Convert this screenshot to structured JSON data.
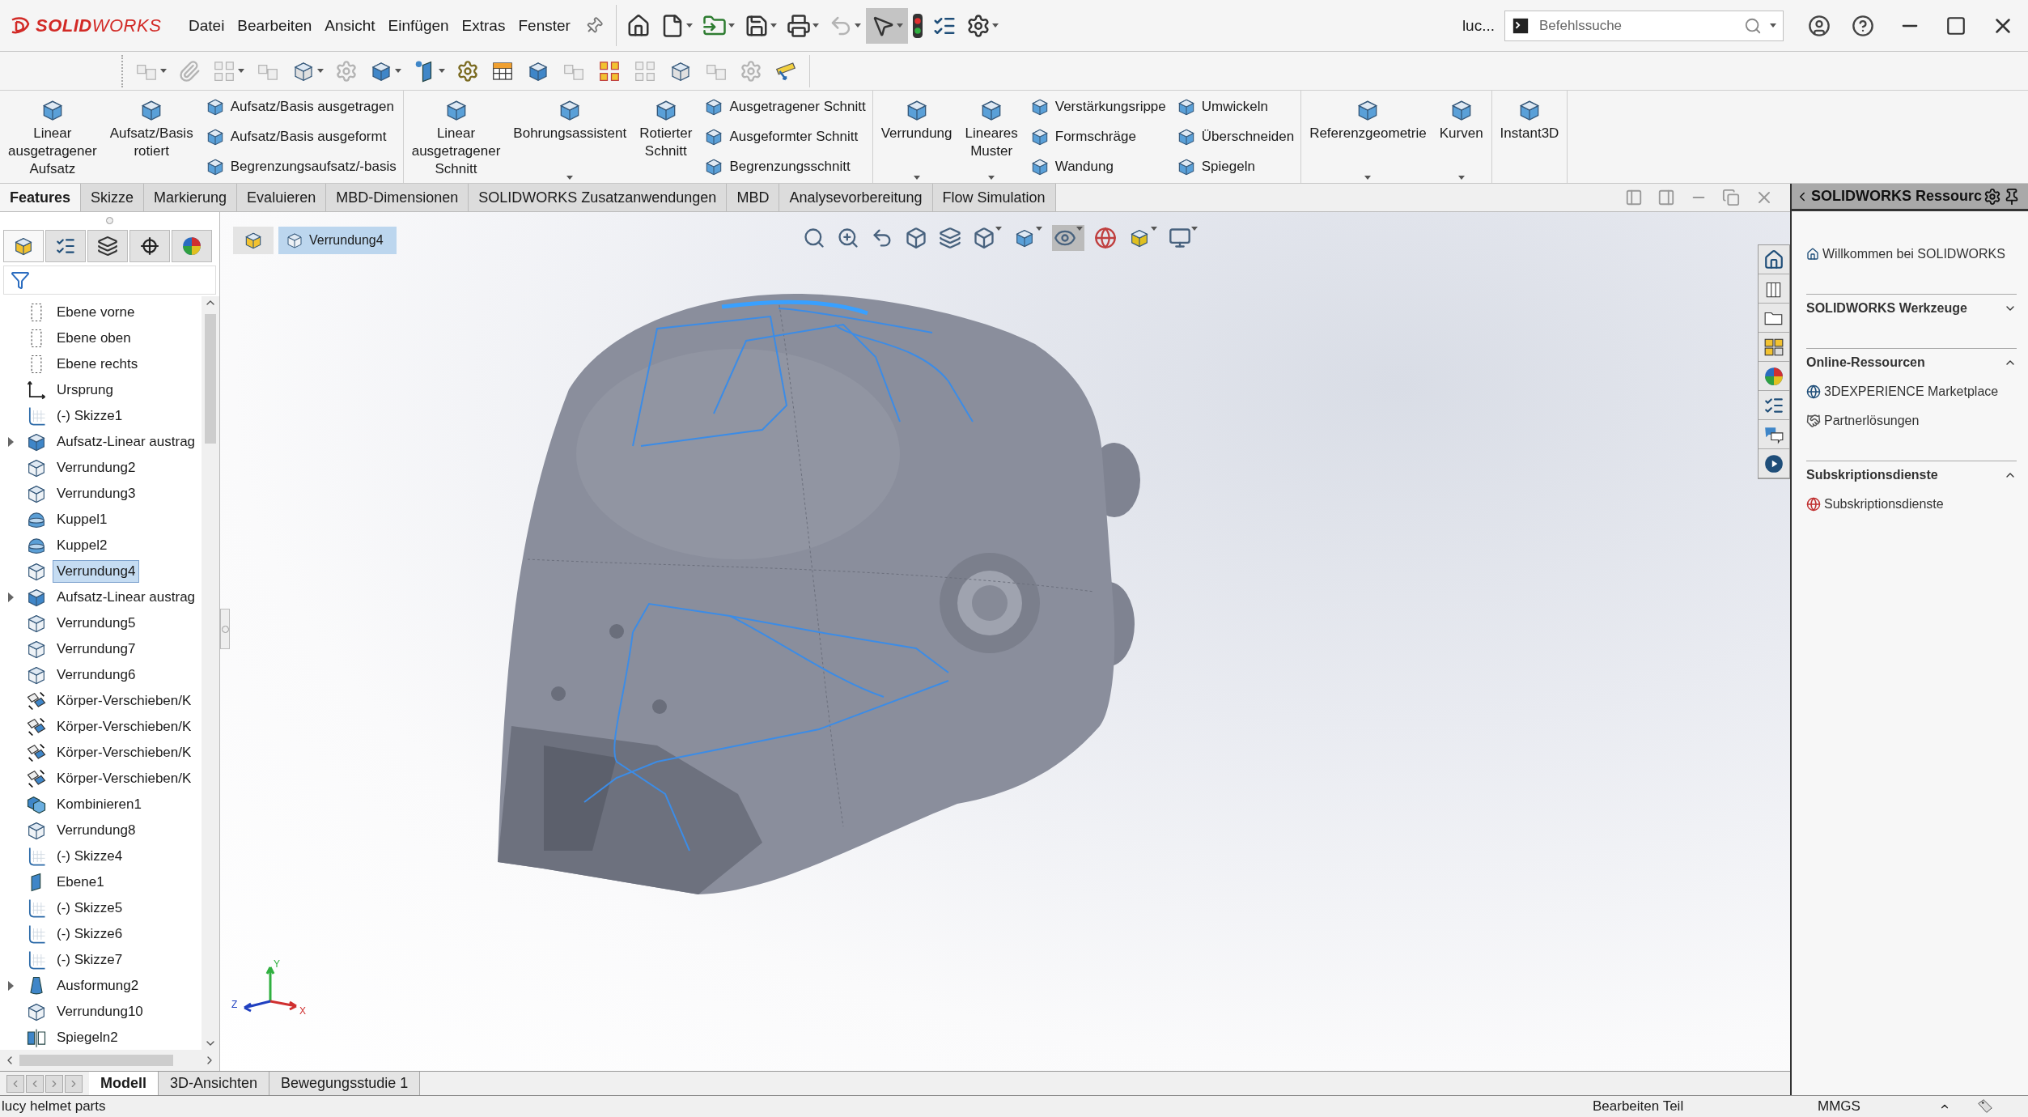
{
  "app": {
    "logo": "**SOLID**WORKS"
  },
  "menu": [
    "Datei",
    "Bearbeiten",
    "Ansicht",
    "Einfügen",
    "Extras",
    "Fenster"
  ],
  "main_toolbar": [
    {
      "kind": "home",
      "menu": false,
      "disabled": false,
      "pressed": false
    },
    {
      "kind": "new",
      "menu": true,
      "disabled": false,
      "pressed": false
    },
    {
      "kind": "open",
      "menu": true,
      "disabled": false,
      "pressed": false
    },
    {
      "kind": "save",
      "menu": true,
      "disabled": false,
      "pressed": false
    },
    {
      "kind": "print",
      "menu": true,
      "disabled": false,
      "pressed": false
    },
    {
      "kind": "undo",
      "menu": true,
      "disabled": true,
      "pressed": false
    },
    {
      "kind": "select",
      "menu": true,
      "disabled": false,
      "pressed": true
    },
    {
      "kind": "traffic",
      "menu": false,
      "disabled": false,
      "pressed": false
    },
    {
      "kind": "list",
      "menu": false,
      "disabled": false,
      "pressed": false
    },
    {
      "kind": "gear",
      "menu": true,
      "disabled": false,
      "pressed": false
    }
  ],
  "user": "luc...",
  "search": {
    "placeholder": "Befehlssuche"
  },
  "quick_toolbar": [
    {
      "kind": "parts",
      "disabled": true,
      "menu": true
    },
    {
      "kind": "clip",
      "disabled": true,
      "menu": false
    },
    {
      "kind": "grid",
      "disabled": true,
      "menu": true
    },
    {
      "kind": "parts",
      "disabled": true,
      "menu": false
    },
    {
      "kind": "box",
      "disabled": true,
      "menu": true
    },
    {
      "kind": "gears",
      "disabled": true,
      "menu": false
    },
    {
      "kind": "box",
      "disabled": false,
      "menu": true
    },
    {
      "kind": "plane",
      "disabled": false,
      "menu": true
    },
    {
      "kind": "gears",
      "disabled": false,
      "menu": false
    },
    {
      "kind": "table",
      "disabled": false,
      "menu": false
    },
    {
      "kind": "box",
      "disabled": false,
      "menu": false
    },
    {
      "kind": "parts",
      "disabled": true,
      "menu": false
    },
    {
      "kind": "grid",
      "disabled": false,
      "menu": false
    },
    {
      "kind": "grid",
      "disabled": true,
      "menu": false
    },
    {
      "kind": "box",
      "disabled": true,
      "menu": false
    },
    {
      "kind": "parts",
      "disabled": true,
      "menu": false
    },
    {
      "kind": "gears",
      "disabled": true,
      "menu": false
    },
    {
      "kind": "ruler",
      "disabled": false,
      "menu": false
    }
  ],
  "ribbon": [
    {
      "items": [
        {
          "kind": "large",
          "label": "Linear\nausgetragener\nAufsatz",
          "menu": false
        },
        {
          "kind": "large",
          "label": "Aufsatz/Basis\nrotiert",
          "menu": false
        },
        {
          "kind": "column",
          "items": [
            "Aufsatz/Basis ausgetragen",
            "Aufsatz/Basis ausgeformt",
            "Begrenzungsaufsatz/-basis"
          ]
        }
      ]
    },
    {
      "items": [
        {
          "kind": "large",
          "label": "Linear\nausgetragener\nSchnitt",
          "menu": false
        },
        {
          "kind": "large",
          "label": "Bohrungsassistent",
          "menu": true
        },
        {
          "kind": "large",
          "label": "Rotierter\nSchnitt",
          "menu": false
        },
        {
          "kind": "column",
          "items": [
            "Ausgetragener Schnitt",
            "Ausgeformter Schnitt",
            "Begrenzungsschnitt"
          ]
        }
      ]
    },
    {
      "items": [
        {
          "kind": "large",
          "label": "Verrundung",
          "menu": true
        },
        {
          "kind": "large",
          "label": "Lineares\nMuster",
          "menu": true
        },
        {
          "kind": "column",
          "items": [
            "Verstärkungsrippe",
            "Formschräge",
            "Wandung"
          ]
        },
        {
          "kind": "column",
          "items": [
            "Umwickeln",
            "Überschneiden",
            "Spiegeln"
          ]
        }
      ]
    },
    {
      "items": [
        {
          "kind": "large",
          "label": "Referenzgeometrie",
          "menu": true
        },
        {
          "kind": "large",
          "label": "Kurven",
          "menu": true
        }
      ]
    },
    {
      "items": [
        {
          "kind": "large",
          "label": "Instant3D",
          "menu": false
        }
      ]
    }
  ],
  "feature_tabs": [
    {
      "label": "Features",
      "selected": true
    },
    {
      "label": "Skizze",
      "selected": false
    },
    {
      "label": "Markierung",
      "selected": false
    },
    {
      "label": "Evaluieren",
      "selected": false
    },
    {
      "label": "MBD-Dimensionen",
      "selected": false
    },
    {
      "label": "SOLIDWORKS Zusatzanwendungen",
      "selected": false
    },
    {
      "label": "MBD",
      "selected": false
    },
    {
      "label": "Analysevorbereitung",
      "selected": false
    },
    {
      "label": "Flow Simulation",
      "selected": false
    }
  ],
  "tree": {
    "items": [
      {
        "label": "Ebene vorne",
        "kind": "plane",
        "expandable": false,
        "selected": false
      },
      {
        "label": "Ebene oben",
        "kind": "plane",
        "expandable": false,
        "selected": false
      },
      {
        "label": "Ebene rechts",
        "kind": "plane",
        "expandable": false,
        "selected": false
      },
      {
        "label": "Ursprung",
        "kind": "origin",
        "expandable": false,
        "selected": false
      },
      {
        "label": "(-) Skizze1",
        "kind": "sketch",
        "expandable": false,
        "selected": false
      },
      {
        "label": "Aufsatz-Linear austrag",
        "kind": "extrude",
        "expandable": true,
        "selected": false
      },
      {
        "label": "Verrundung2",
        "kind": "fillet",
        "expandable": false,
        "selected": false
      },
      {
        "label": "Verrundung3",
        "kind": "fillet",
        "expandable": false,
        "selected": false
      },
      {
        "label": "Kuppel1",
        "kind": "dome",
        "expandable": false,
        "selected": false
      },
      {
        "label": "Kuppel2",
        "kind": "dome",
        "expandable": false,
        "selected": false
      },
      {
        "label": "Verrundung4",
        "kind": "fillet",
        "expandable": false,
        "selected": true
      },
      {
        "label": "Aufsatz-Linear austrag",
        "kind": "extrude",
        "expandable": true,
        "selected": false
      },
      {
        "label": "Verrundung5",
        "kind": "fillet",
        "expandable": false,
        "selected": false
      },
      {
        "label": "Verrundung7",
        "kind": "fillet",
        "expandable": false,
        "selected": false
      },
      {
        "label": "Verrundung6",
        "kind": "fillet",
        "expandable": false,
        "selected": false
      },
      {
        "label": "Körper-Verschieben/K",
        "kind": "move",
        "expandable": false,
        "selected": false
      },
      {
        "label": "Körper-Verschieben/K",
        "kind": "move",
        "expandable": false,
        "selected": false
      },
      {
        "label": "Körper-Verschieben/K",
        "kind": "move",
        "expandable": false,
        "selected": false
      },
      {
        "label": "Körper-Verschieben/K",
        "kind": "move",
        "expandable": false,
        "selected": false
      },
      {
        "label": "Kombinieren1",
        "kind": "combine",
        "expandable": false,
        "selected": false
      },
      {
        "label": "Verrundung8",
        "kind": "fillet",
        "expandable": false,
        "selected": false
      },
      {
        "label": "(-) Skizze4",
        "kind": "sketch",
        "expandable": false,
        "selected": false
      },
      {
        "label": "Ebene1",
        "kind": "refplane",
        "expandable": false,
        "selected": false
      },
      {
        "label": "(-) Skizze5",
        "kind": "sketch",
        "expandable": false,
        "selected": false
      },
      {
        "label": "(-) Skizze6",
        "kind": "sketch",
        "expandable": false,
        "selected": false
      },
      {
        "label": "(-) Skizze7",
        "kind": "sketch",
        "expandable": false,
        "selected": false
      },
      {
        "label": "Ausformung2",
        "kind": "loft",
        "expandable": true,
        "selected": false
      },
      {
        "label": "Verrundung10",
        "kind": "fillet",
        "expandable": false,
        "selected": false
      },
      {
        "label": "Spiegeln2",
        "kind": "mirror",
        "expandable": false,
        "selected": false
      }
    ]
  },
  "panel_tabs": [
    {
      "selected": true
    },
    {
      "selected": false
    },
    {
      "selected": false
    },
    {
      "selected": false
    },
    {
      "selected": false
    }
  ],
  "breadcrumb": "Verrundung4",
  "triad_labels": [
    "Y",
    "Z",
    "X"
  ],
  "task_pane": {
    "title": "SOLIDWORKS Ressourc",
    "welcome": "Willkommen bei SOLIDWORKS",
    "sections": [
      {
        "title": "SOLIDWORKS Werkzeuge",
        "expanded": false
      },
      {
        "title": "Online-Ressourcen",
        "expanded": true,
        "items": [
          {
            "label": "3DEXPERIENCE Marketplace",
            "kind": "globe"
          },
          {
            "label": "Partnerlösungen",
            "kind": "handshake"
          }
        ]
      },
      {
        "title": "Subskriptionsdienste",
        "expanded": true,
        "items": [
          {
            "label": "Subskriptionsdienste",
            "kind": "service"
          }
        ]
      }
    ]
  },
  "bottom_tabs": [
    {
      "label": "Modell",
      "selected": true
    },
    {
      "label": "3D-Ansichten",
      "selected": false
    },
    {
      "label": "Bewegungsstudie 1",
      "selected": false
    }
  ],
  "status_bar": {
    "document": "lucy helmet parts",
    "mode": "Bearbeiten Teil",
    "units": "MMGS"
  }
}
